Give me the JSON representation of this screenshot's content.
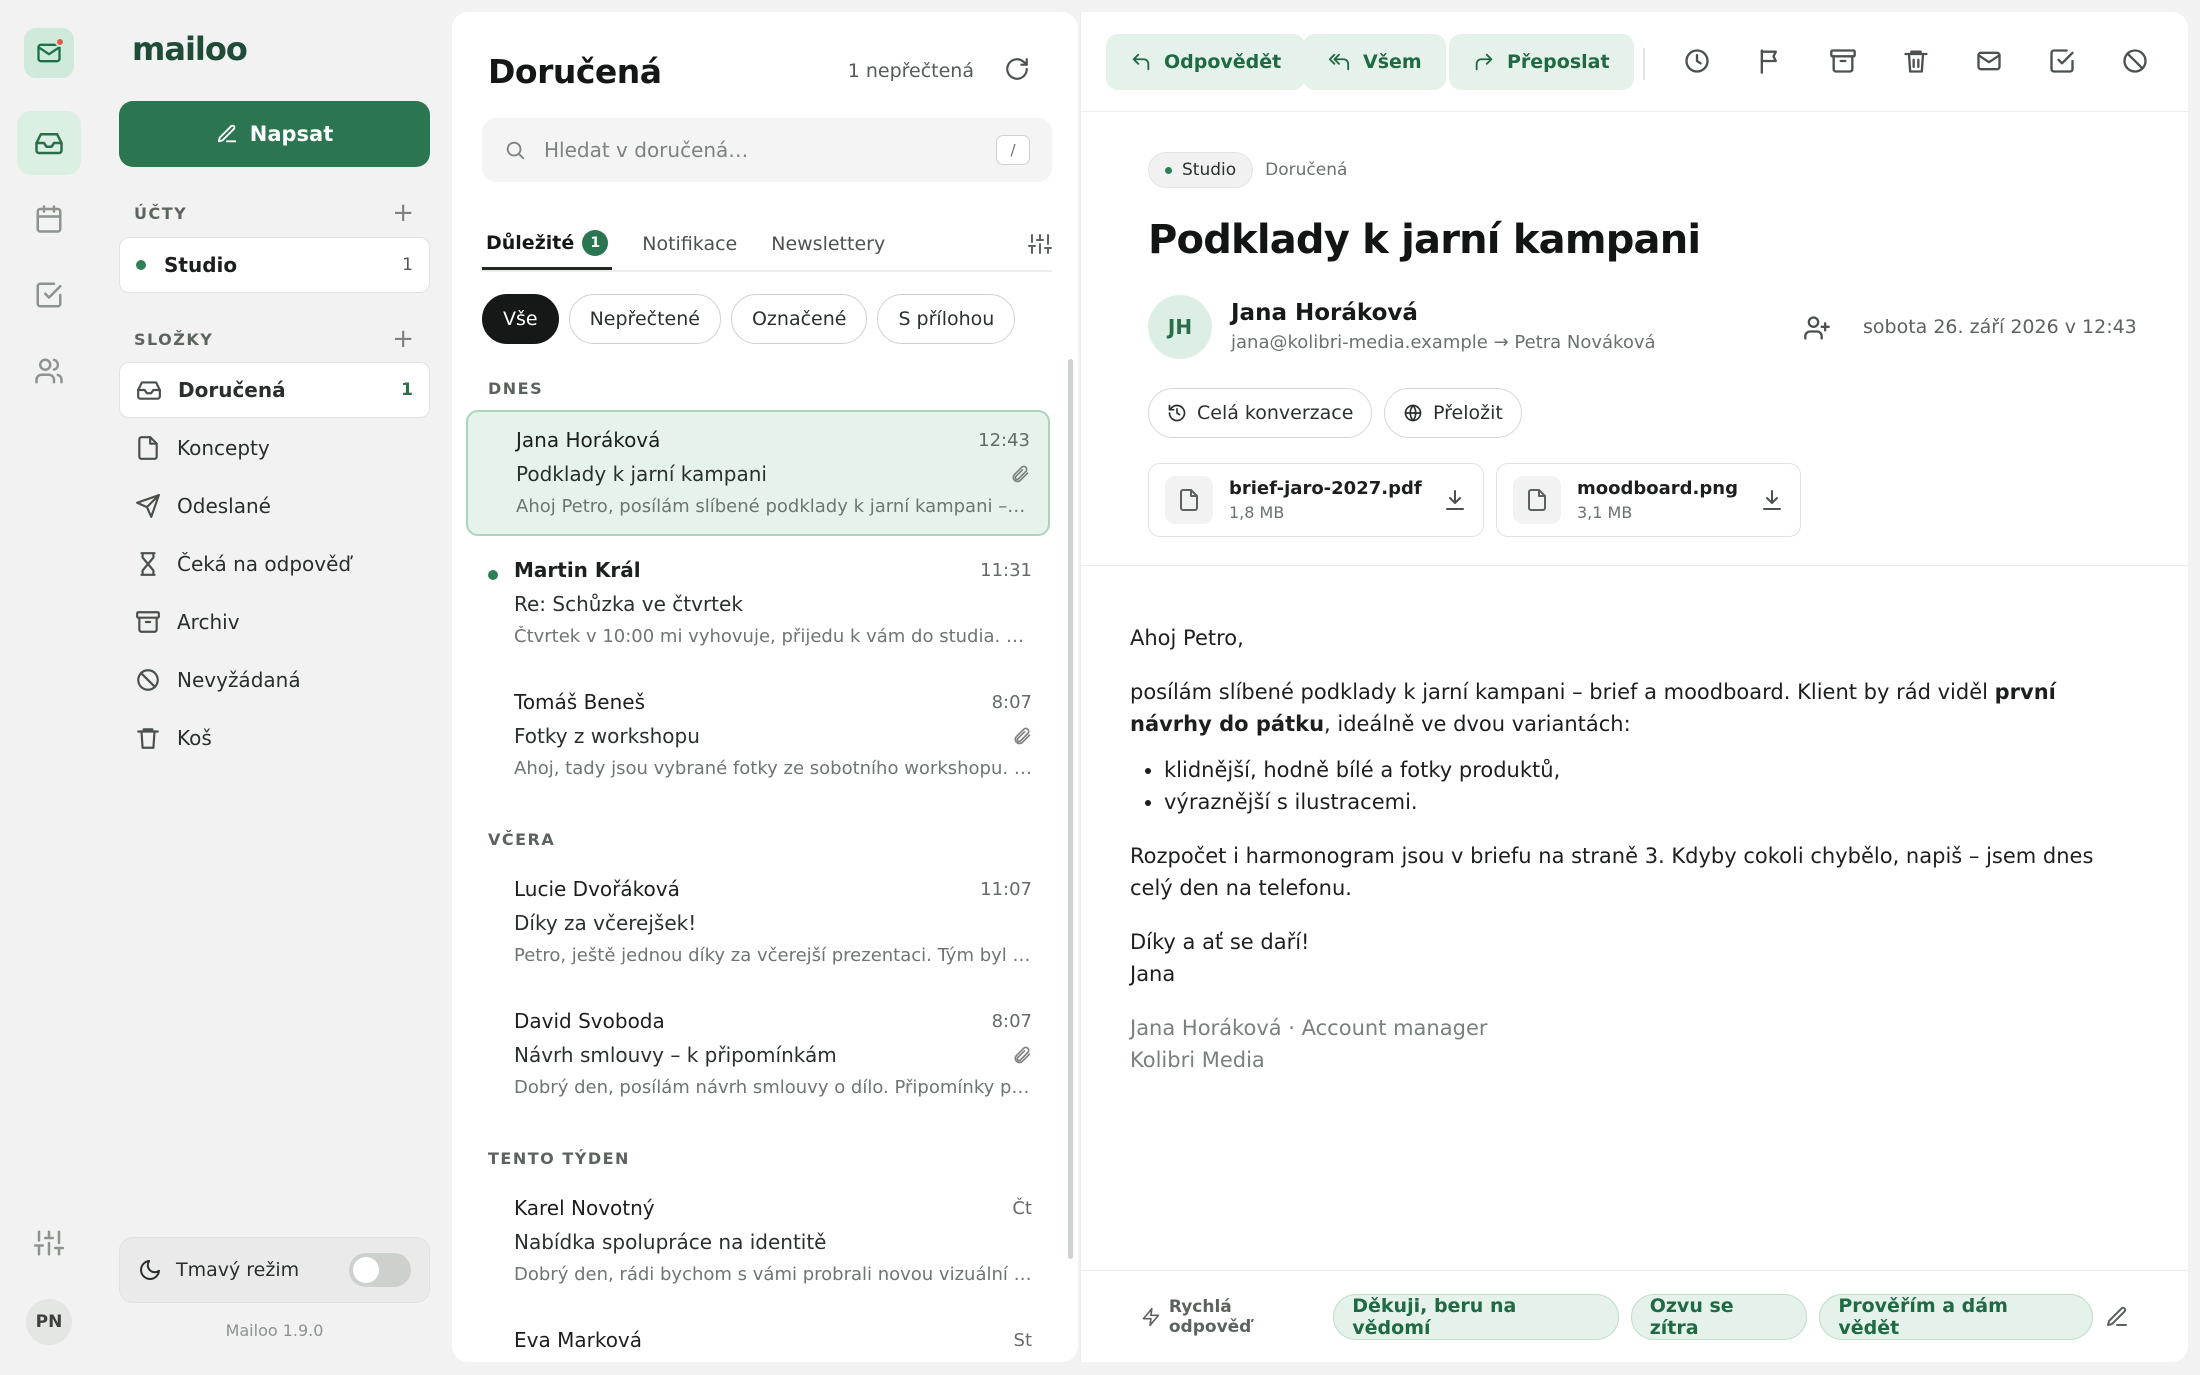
{
  "app": {
    "name": "mailoo",
    "version": "Mailoo 1.9.0",
    "user_initials": "PN"
  },
  "sidebar": {
    "compose_label": "Napsat",
    "accounts_header": "ÚČTY",
    "accounts": [
      {
        "name": "Studio",
        "count": "1"
      }
    ],
    "folders_header": "SLOŽKY",
    "folders": [
      {
        "label": "Doručená",
        "count": "1",
        "icon": "inbox-icon"
      },
      {
        "label": "Koncepty",
        "count": "",
        "icon": "file-icon"
      },
      {
        "label": "Odeslané",
        "count": "",
        "icon": "send-icon"
      },
      {
        "label": "Čeká na odpověď",
        "count": "",
        "icon": "hourglass-icon"
      },
      {
        "label": "Archiv",
        "count": "",
        "icon": "archive-icon"
      },
      {
        "label": "Nevyžádaná",
        "count": "",
        "icon": "ban-icon"
      },
      {
        "label": "Koš",
        "count": "",
        "icon": "trash-icon"
      }
    ],
    "dark_mode_label": "Tmavý režim",
    "dark_mode_on": false
  },
  "list": {
    "title": "Doručená",
    "unread_label": "1 nepřečtená",
    "search_placeholder": "Hledat v doručená…",
    "search_shortcut": "/",
    "tabs": [
      {
        "label": "Důležité",
        "badge": "1"
      },
      {
        "label": "Notifikace",
        "badge": ""
      },
      {
        "label": "Newslettery",
        "badge": ""
      }
    ],
    "filters": [
      "Vše",
      "Nepřečtené",
      "Označené",
      "S přílohou"
    ],
    "groups": [
      "DNES",
      "VČERA",
      "TENTO TÝDEN"
    ],
    "messages": [
      {
        "from": "Jana Horáková",
        "time": "12:43",
        "subject": "Podklady k jarní kampani",
        "preview": "Ahoj Petro, posílám slíbené podklady k jarní kampani – brief a moodboard.",
        "attachment": true,
        "unread": false,
        "selected": true
      },
      {
        "from": "Martin Král",
        "time": "11:31",
        "subject": "Re: Schůzka ve čtvrtek",
        "preview": "Čtvrtek v 10:00 mi vyhovuje, přijedu k vám do studia. Ve…",
        "attachment": false,
        "unread": true,
        "selected": false
      },
      {
        "from": "Tomáš Beneš",
        "time": "8:07",
        "subject": "Fotky z workshopu",
        "preview": "Ahoj, tady jsou vybrané fotky ze sobotního workshopu. …",
        "attachment": true,
        "unread": false,
        "selected": false
      },
      {
        "from": "Lucie Dvořáková",
        "time": "11:07",
        "subject": "Díky za včerejšek!",
        "preview": "Petro, ještě jednou díky za včerejší prezentaci. Tým byl n…",
        "attachment": false,
        "unread": false,
        "selected": false
      },
      {
        "from": "David Svoboda",
        "time": "8:07",
        "subject": "Návrh smlouvy – k připomínkám",
        "preview": "Dobrý den, posílám návrh smlouvy o dílo. Připomínky pr…",
        "attachment": true,
        "unread": false,
        "selected": false
      },
      {
        "from": "Karel Novotný",
        "time": "Čt",
        "subject": "Nabídka spolupráce na identitě",
        "preview": "Dobrý den, rádi bychom s vámi probrali novou vizuální id…",
        "attachment": false,
        "unread": false,
        "selected": false
      },
      {
        "from": "Eva Marková",
        "time": "St",
        "subject": "",
        "preview": "",
        "attachment": false,
        "unread": false,
        "selected": false
      }
    ]
  },
  "reader": {
    "actions": [
      "Odpovědět",
      "Všem",
      "Přeposlat"
    ],
    "icons": [
      "clock-icon",
      "flag-icon",
      "archive-icon",
      "trash-icon",
      "mail-icon",
      "checkbox-icon",
      "ban-icon"
    ],
    "tag": "Studio",
    "folder": "Doručená",
    "subject": "Podklady k jarní kampani",
    "sender_initials": "JH",
    "sender_name": "Jana Horáková",
    "sender_address": "jana@kolibri-media.example → Petra Nováková",
    "date": "sobota 26. září 2026 v 12:43",
    "conversation_label": "Celá konverzace",
    "translate_label": "Přeložit",
    "attachments": [
      {
        "name": "brief-jaro-2027.pdf",
        "size": "1,8 MB"
      },
      {
        "name": "moodboard.png",
        "size": "3,1 MB"
      }
    ],
    "body": {
      "greeting": "Ahoj Petro,",
      "p1_start": "posílám slíbené podklady k jarní kampani – brief a moodboard. Klient by rád viděl ",
      "p1_bold": "první návrhy do pátku",
      "p1_end": ", ideálně ve dvou variantách:",
      "bullets": [
        "klidnější, hodně bílé a fotky produktů,",
        "výraznější s ilustracemi."
      ],
      "p2": "Rozpočet i harmonogram jsou v briefu na straně 3. Kdyby cokoli chybělo, napiš – jsem dnes celý den na telefonu.",
      "closing": "Díky a ať se daří!",
      "name": "Jana",
      "sig1": "Jana Horáková · Account manager",
      "sig2": "Kolibri Media"
    },
    "quick_reply_label": "Rychlá odpověď",
    "quick_replies": [
      "Děkuji, beru na vědomí",
      "Ozvu se zítra",
      "Prověřím a dám vědět"
    ]
  }
}
